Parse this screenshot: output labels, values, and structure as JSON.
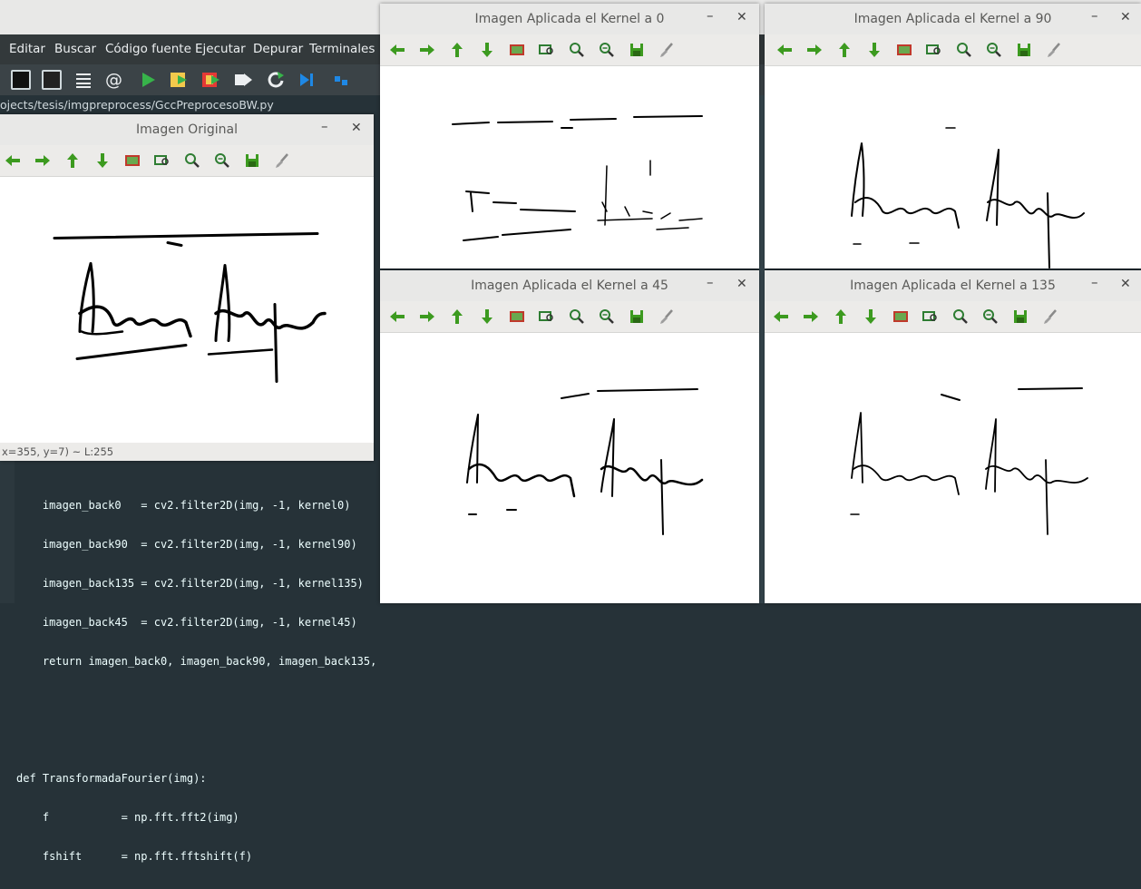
{
  "ide": {
    "menu": [
      "Editar",
      "Buscar",
      "Código fuente",
      "Ejecutar",
      "Depurar",
      "Terminales"
    ],
    "path": "ojects/tesis/imgpreprocess/GccPreprocesoBW.py",
    "code_lines": [
      {
        "text": "    imagen_back0   = cv2.filter2D(img, -1, kernel0)"
      },
      {
        "text": "    imagen_back90  = cv2.filter2D(img, -1, kernel90)"
      },
      {
        "text": "    imagen_back135 = cv2.filter2D(img, -1, kernel135)"
      },
      {
        "text": "    imagen_back45  = cv2.filter2D(img, -1, kernel45)"
      },
      {
        "text": "    return imagen_back0, imagen_back90, imagen_back135,"
      },
      {
        "text": ""
      },
      {
        "text": ""
      },
      {
        "text": "def TransformadaFourier(img):"
      },
      {
        "text": "    f           = np.fft.fft2(img)"
      },
      {
        "text": "    fshift      = np.fft.fftshift(f)"
      }
    ]
  },
  "windows": {
    "original": {
      "title": "Imagen Original",
      "status": "x=355, y=7) ~ L:255"
    },
    "k0": {
      "title": "Imagen Aplicada el Kernel a  0"
    },
    "k90": {
      "title": "Imagen Aplicada el Kernel a  90"
    },
    "k45": {
      "title": "Imagen Aplicada el Kernel a  45"
    },
    "k135": {
      "title": "Imagen Aplicada el Kernel a 135"
    }
  },
  "window_controls": {
    "minimize": "–",
    "close": "✕"
  },
  "toolbar_icons": [
    "arrow-left-icon",
    "arrow-right-icon",
    "arrow-up-icon",
    "arrow-down-icon",
    "image-icon",
    "zoom-fit-icon",
    "zoom-in-icon",
    "zoom-out-icon",
    "save-icon",
    "brush-icon"
  ],
  "colors": {
    "toolbar_green": "#3c9a1f",
    "ide_bg": "#263238",
    "titlebar": "#e8e8e7"
  }
}
